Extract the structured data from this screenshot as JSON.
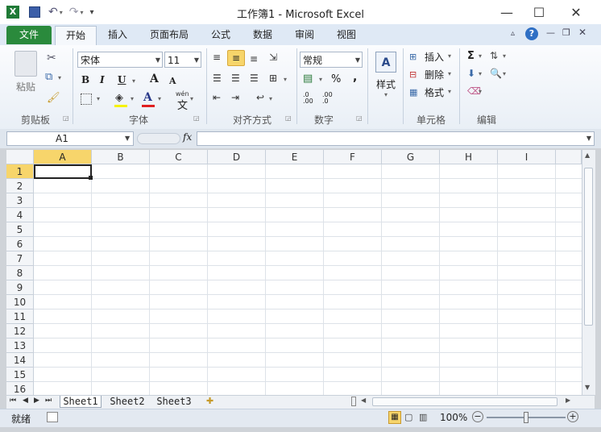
{
  "window": {
    "title": "工作簿1 - Microsoft Excel",
    "minimize_glyph": "—",
    "maximize_glyph": "☐",
    "close_glyph": "✕"
  },
  "tabs": [
    {
      "label": "文件"
    },
    {
      "label": "开始"
    },
    {
      "label": "插入"
    },
    {
      "label": "页面布局"
    },
    {
      "label": "公式"
    },
    {
      "label": "数据"
    },
    {
      "label": "审阅"
    },
    {
      "label": "视图"
    }
  ],
  "ribbon": {
    "clipboard": {
      "paste": "粘贴",
      "group": "剪贴板"
    },
    "font": {
      "name": "宋体",
      "size": "11",
      "bold": "B",
      "italic": "I",
      "underline": "U",
      "grow": "A",
      "shrink": "A",
      "group": "字体",
      "wen": "wén",
      "wen_char": "文"
    },
    "alignment": {
      "group": "对齐方式"
    },
    "number": {
      "format": "常规",
      "percent": "%",
      "comma": ",",
      "inc": ".0 .00",
      "dec": ".00 .0",
      "group": "数字"
    },
    "styles": {
      "label": "样式"
    },
    "cells": {
      "insert": "插入",
      "delete": "删除",
      "format": "格式",
      "group": "单元格"
    },
    "editing": {
      "sigma": "Σ",
      "group": "编辑"
    }
  },
  "formula_bar": {
    "name_box": "A1",
    "fx": "fx",
    "value": ""
  },
  "grid": {
    "columns": [
      "A",
      "B",
      "C",
      "D",
      "E",
      "F",
      "G",
      "H",
      "I"
    ],
    "rows": [
      "1",
      "2",
      "3",
      "4",
      "5",
      "6",
      "7",
      "8",
      "9",
      "10",
      "11",
      "12",
      "13",
      "14",
      "15",
      "16"
    ],
    "selected_cell": "A1"
  },
  "sheets": [
    "Sheet1",
    "Sheet2",
    "Sheet3"
  ],
  "status": {
    "ready": "就绪",
    "zoom": "100%",
    "minus": "−",
    "plus": "+"
  },
  "colors": {
    "file_tab": "#2a8a3c",
    "selection": "#f7d56b"
  }
}
